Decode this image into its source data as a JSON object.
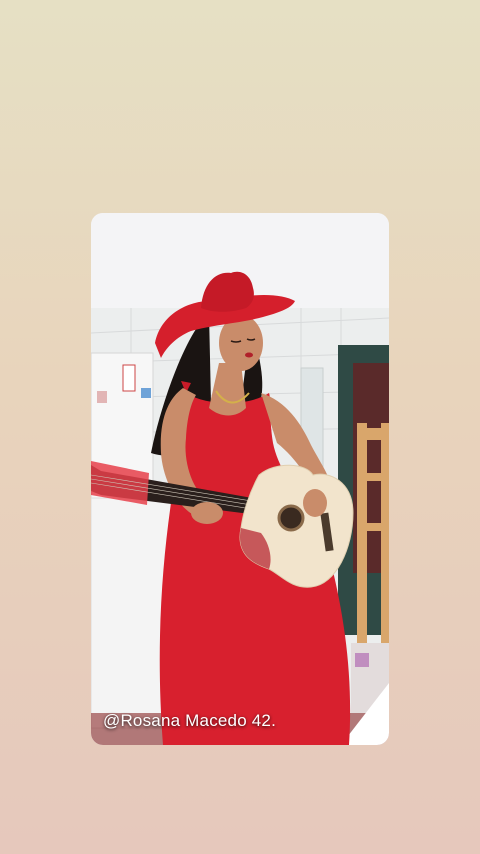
{
  "story": {
    "overlay_text": "@Rosana Macedo 42.",
    "colors": {
      "background_top": "#e6e0c4",
      "background_bottom": "#e6c8bc",
      "dress": "#d8202e",
      "hat": "#d51f2c",
      "guitar_body": "#f2e4cc"
    }
  }
}
